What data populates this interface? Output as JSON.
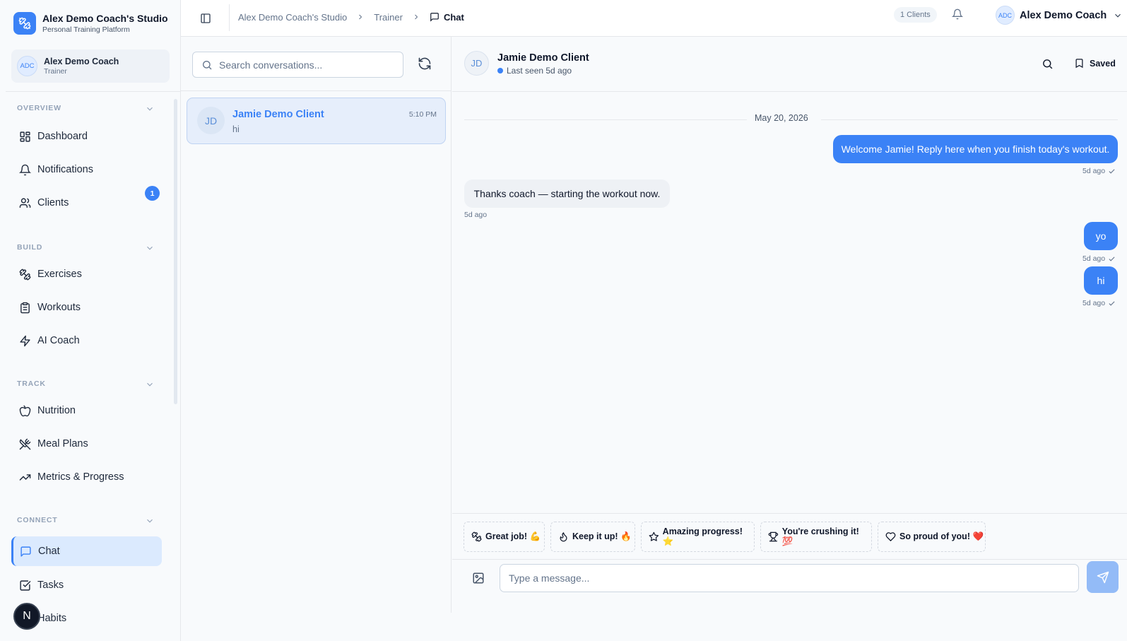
{
  "brand": {
    "title": "Alex Demo Coach's Studio",
    "subtitle": "Personal Training Platform"
  },
  "user": {
    "initials": "ADC",
    "name": "Alex Demo Coach",
    "role": "Trainer"
  },
  "sidebar": {
    "sections": [
      {
        "label": "OVERVIEW"
      },
      {
        "label": "BUILD"
      },
      {
        "label": "TRACK"
      },
      {
        "label": "CONNECT"
      }
    ],
    "items": [
      {
        "label": "Dashboard",
        "icon": "dashboard-icon"
      },
      {
        "label": "Notifications",
        "icon": "bell-icon"
      },
      {
        "label": "Clients",
        "icon": "users-icon",
        "badge": "1"
      },
      {
        "label": "Exercises",
        "icon": "dumbbell-icon"
      },
      {
        "label": "Workouts",
        "icon": "clipboard-icon"
      },
      {
        "label": "AI Coach",
        "icon": "zap-icon"
      },
      {
        "label": "Nutrition",
        "icon": "apple-icon"
      },
      {
        "label": "Meal Plans",
        "icon": "utensils-icon"
      },
      {
        "label": "Metrics & Progress",
        "icon": "trending-up-icon"
      },
      {
        "label": "Chat",
        "icon": "chat-icon",
        "active": true
      },
      {
        "label": "Tasks",
        "icon": "checkbox-icon"
      },
      {
        "label": "Habits",
        "icon": "habits-icon"
      }
    ],
    "fab_label": "N"
  },
  "topbar": {
    "breadcrumbs": [
      "Alex Demo Coach's Studio",
      "Trainer",
      "Chat"
    ],
    "clients_pill": "1 Clients",
    "user_initials": "ADC",
    "user_name": "Alex Demo Coach"
  },
  "conversations": {
    "search_placeholder": "Search conversations...",
    "items": [
      {
        "initials": "JD",
        "name": "Jamie Demo Client",
        "time": "5:10 PM",
        "preview": "hi"
      }
    ]
  },
  "chat": {
    "contact_initials": "JD",
    "contact_name": "Jamie Demo Client",
    "status": "Last seen 5d ago",
    "saved_label": "Saved",
    "date_divider": "May 20, 2026",
    "messages": [
      {
        "direction": "out",
        "text": "Welcome Jamie! Reply here when you finish today's workout.",
        "time": "5d ago"
      },
      {
        "direction": "in",
        "text": "Thanks coach — starting the workout now.",
        "time": "5d ago"
      },
      {
        "direction": "out",
        "text": "yo",
        "time": "5d ago"
      },
      {
        "direction": "out",
        "text": "hi",
        "time": "5d ago"
      }
    ],
    "quick_replies": [
      {
        "text": "Great job! 💪",
        "icon": "dumbbell-icon"
      },
      {
        "text": "Keep it up! 🔥",
        "icon": "flame-icon"
      },
      {
        "text": "Amazing progress! ⭐",
        "icon": "star-icon"
      },
      {
        "text": "You're crushing it! 💯",
        "icon": "trophy-icon"
      },
      {
        "text": "So proud of you! ❤️",
        "icon": "heart-icon"
      }
    ],
    "composer_placeholder": "Type a message..."
  },
  "colors": {
    "accent": "#3b82f6",
    "active_bg": "#dbeafe",
    "send_disabled": "#93bbf7"
  }
}
